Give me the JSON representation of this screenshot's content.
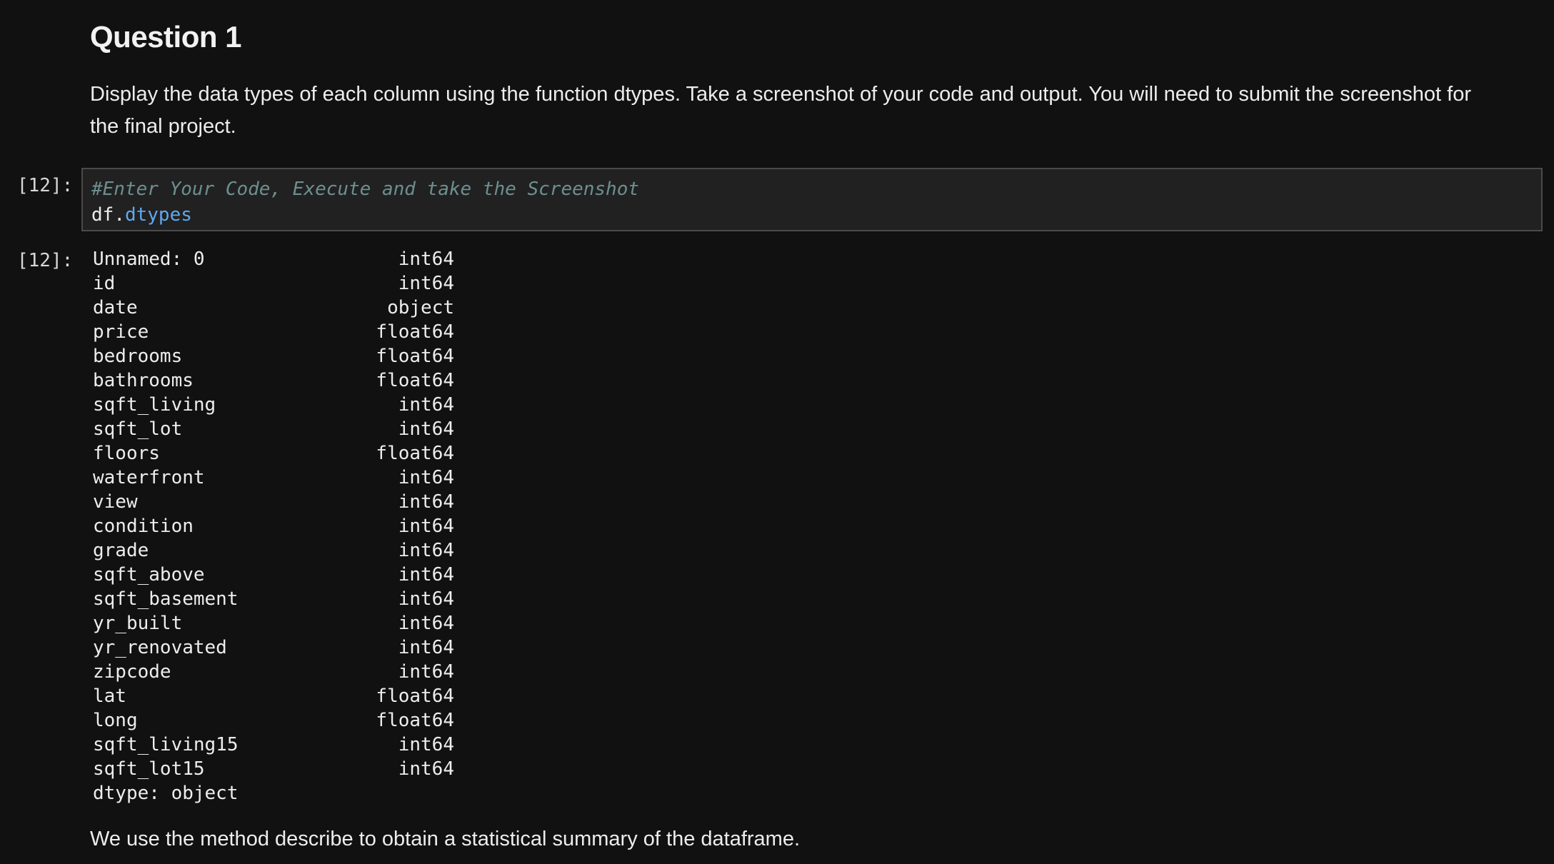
{
  "markdown": {
    "heading": "Question 1",
    "instructions": "Display the data types of each column using the function dtypes. Take a screenshot of your code and output. You will need to submit the screenshot for the final project.",
    "follow_up": "We use the method describe to obtain a statistical summary of the dataframe."
  },
  "code_cell": {
    "in_prompt": "[12]:",
    "comment": "#Enter Your Code, Execute and take the Screenshot",
    "code_object": "df",
    "code_dot": ".",
    "code_attribute": "dtypes"
  },
  "output_cell": {
    "out_prompt": "[12]:",
    "rows": [
      {
        "column": "Unnamed: 0",
        "dtype": "int64"
      },
      {
        "column": "id",
        "dtype": "int64"
      },
      {
        "column": "date",
        "dtype": "object"
      },
      {
        "column": "price",
        "dtype": "float64"
      },
      {
        "column": "bedrooms",
        "dtype": "float64"
      },
      {
        "column": "bathrooms",
        "dtype": "float64"
      },
      {
        "column": "sqft_living",
        "dtype": "int64"
      },
      {
        "column": "sqft_lot",
        "dtype": "int64"
      },
      {
        "column": "floors",
        "dtype": "float64"
      },
      {
        "column": "waterfront",
        "dtype": "int64"
      },
      {
        "column": "view",
        "dtype": "int64"
      },
      {
        "column": "condition",
        "dtype": "int64"
      },
      {
        "column": "grade",
        "dtype": "int64"
      },
      {
        "column": "sqft_above",
        "dtype": "int64"
      },
      {
        "column": "sqft_basement",
        "dtype": "int64"
      },
      {
        "column": "yr_built",
        "dtype": "int64"
      },
      {
        "column": "yr_renovated",
        "dtype": "int64"
      },
      {
        "column": "zipcode",
        "dtype": "int64"
      },
      {
        "column": "lat",
        "dtype": "float64"
      },
      {
        "column": "long",
        "dtype": "float64"
      },
      {
        "column": "sqft_living15",
        "dtype": "int64"
      },
      {
        "column": "sqft_lot15",
        "dtype": "int64"
      }
    ],
    "footer": "dtype: object"
  },
  "colors": {
    "background": "#111111",
    "code_background": "#212121",
    "comment": "#6d8f8f",
    "attribute": "#5fa8f0"
  }
}
